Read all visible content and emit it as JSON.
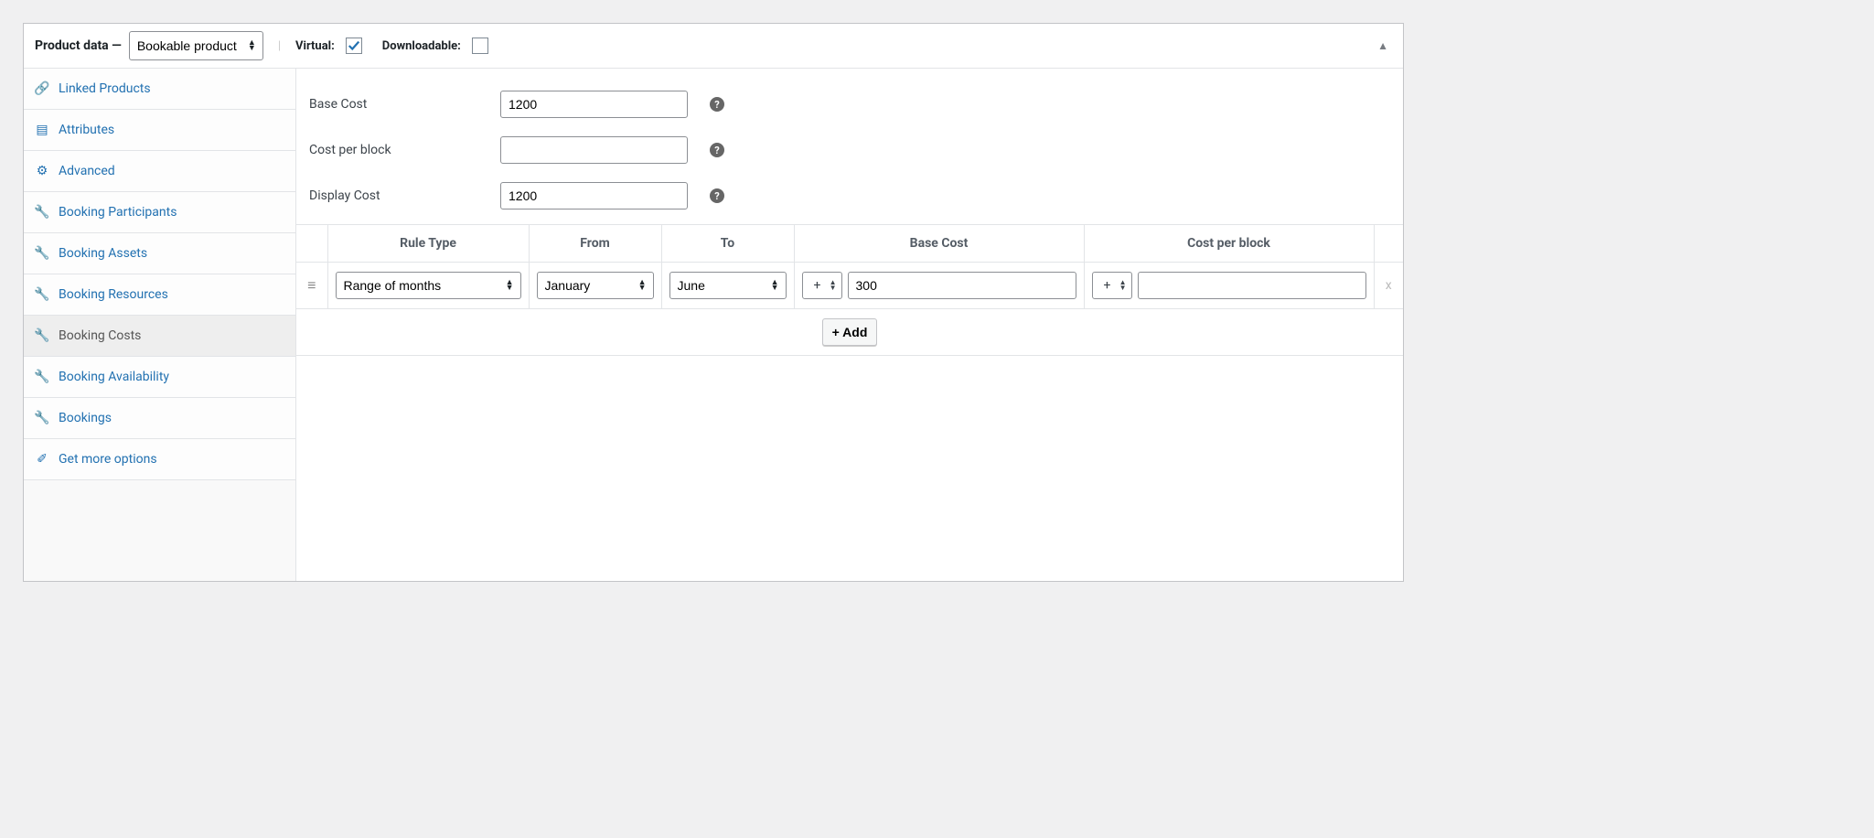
{
  "header": {
    "title": "Product data —",
    "product_type": "Bookable product",
    "virtual_label": "Virtual:",
    "virtual_checked": true,
    "downloadable_label": "Downloadable:",
    "downloadable_checked": false
  },
  "sidebar": {
    "items": [
      {
        "icon": "link",
        "label": "Linked Products"
      },
      {
        "icon": "card",
        "label": "Attributes"
      },
      {
        "icon": "gear",
        "label": "Advanced"
      },
      {
        "icon": "wrench",
        "label": "Booking Participants"
      },
      {
        "icon": "wrench",
        "label": "Booking Assets"
      },
      {
        "icon": "wrench",
        "label": "Booking Resources"
      },
      {
        "icon": "wrench",
        "label": "Booking Costs"
      },
      {
        "icon": "wrench",
        "label": "Booking Availability"
      },
      {
        "icon": "wrench",
        "label": "Bookings"
      },
      {
        "icon": "pointer",
        "label": "Get more options"
      }
    ],
    "active_index": 6
  },
  "form": {
    "base_cost_label": "Base Cost",
    "base_cost_value": "1200",
    "cost_per_block_label": "Cost per block",
    "cost_per_block_value": "",
    "display_cost_label": "Display Cost",
    "display_cost_value": "1200"
  },
  "rules": {
    "headers": {
      "rule_type": "Rule Type",
      "from": "From",
      "to": "To",
      "base_cost": "Base Cost",
      "cost_per_block": "Cost per block"
    },
    "row": {
      "rule_type": "Range of months",
      "from": "January",
      "to": "June",
      "base_op": "+",
      "base_value": "300",
      "block_op": "+",
      "block_value": ""
    },
    "add_label": "+ Add",
    "remove_label": "x"
  }
}
